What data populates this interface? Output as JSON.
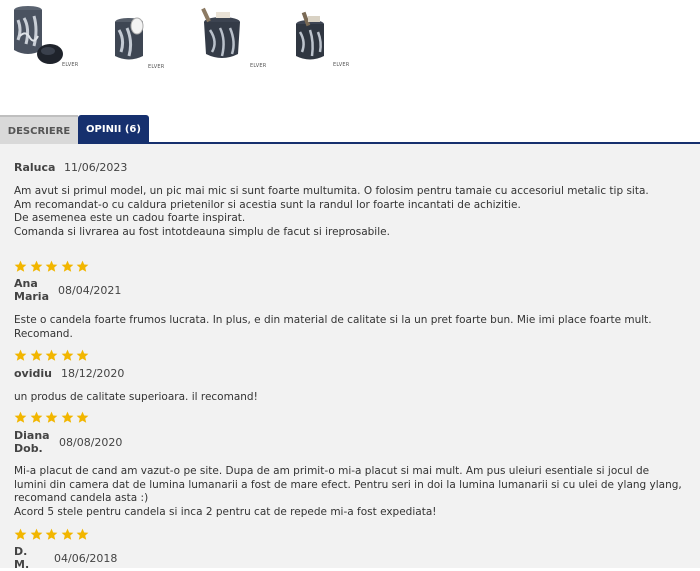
{
  "colors": {
    "star": "#f2b600",
    "tab_active_bg": "#16306e",
    "tab_inactive_bg": "#d9d9d9",
    "panel_bg": "#f2f2f2"
  },
  "gallery": {
    "brand": "ELVER"
  },
  "tabs": {
    "description": "DESCRIERE",
    "reviews": "OPINII (6)"
  },
  "reviews": [
    {
      "author": "Raluca",
      "date": "11/06/2023",
      "rating": 5,
      "lines": [
        "Am avut si primul model, un pic mai mic si sunt foarte multumita. O folosim pentru tamaie cu accesoriul metalic tip sita.",
        "Am recomandat-o cu caldura prietenilor si acestia sunt la randul lor foarte incantati de achizitie.",
        "De asemenea este un cadou foarte inspirat.",
        "Comanda si livrarea au fost intotdeauna simplu de facut si ireprosabile."
      ]
    },
    {
      "author": "Ana Maria",
      "date": "08/04/2021",
      "rating": 5,
      "lines": [
        "Este o candela foarte frumos lucrata. In plus, e din material de calitate si la un pret foarte bun. Mie imi place foarte mult. Recomand."
      ]
    },
    {
      "author": "ovidiu",
      "date": "18/12/2020",
      "rating": 5,
      "lines": [
        "un produs de calitate superioara. il recomand!"
      ]
    },
    {
      "author": "Diana Dob.",
      "date": "08/08/2020",
      "rating": 5,
      "lines": [
        "Mi-a placut de cand am vazut-o pe site. Dupa de am primit-o mi-a placut si mai mult. Am pus uleiuri esentiale si jocul de lumini din camera dat de lumina lumanarii a fost de mare efect. Pentru seri in doi la lumina lumanarii si cu ulei de ylang ylang, recomand candela asta :)",
        "Acord 5 stele pentru candela si inca 2 pentru cat de repede mi-a fost expediata!"
      ]
    },
    {
      "author": "D. M.",
      "date": "04/06/2018",
      "rating": 5,
      "lines": []
    }
  ]
}
